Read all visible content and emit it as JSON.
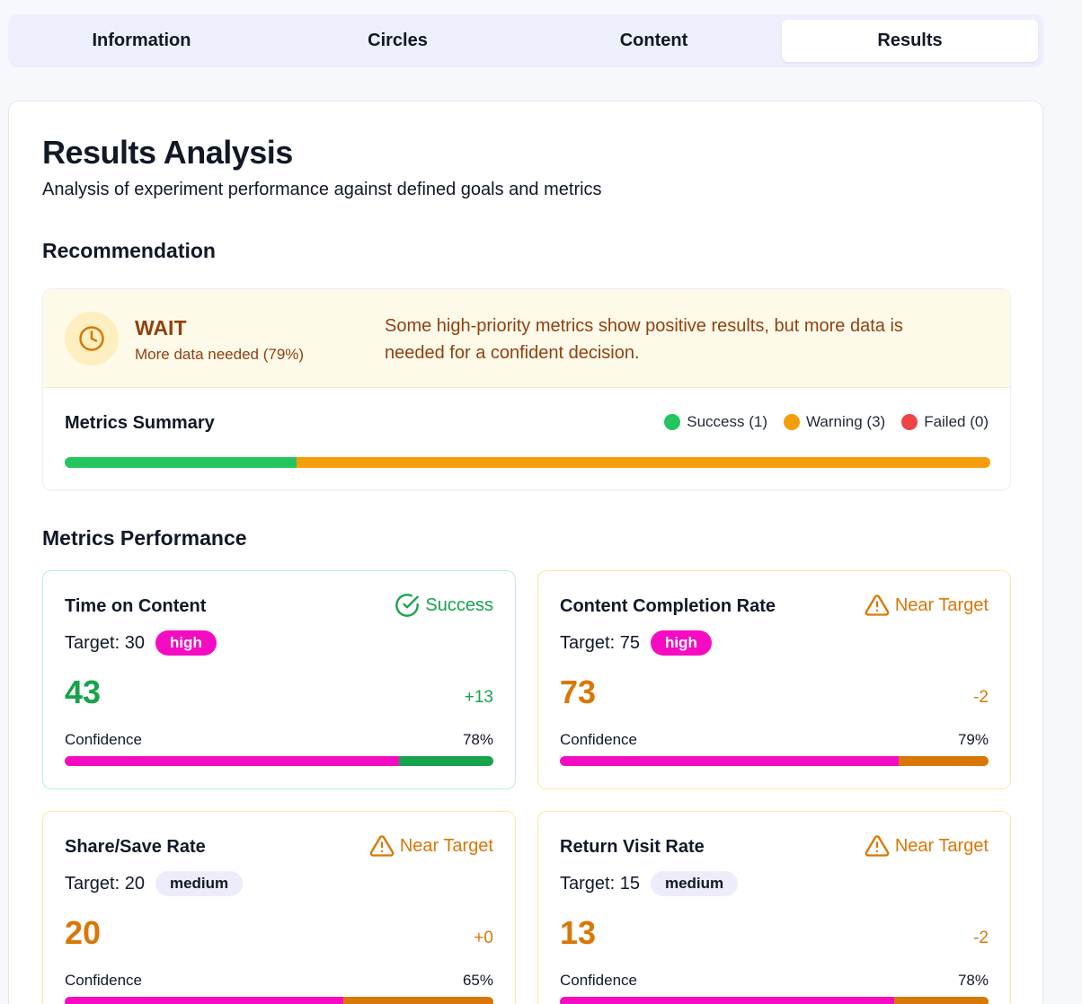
{
  "tabs": [
    {
      "label": "Information",
      "active": false
    },
    {
      "label": "Circles",
      "active": false
    },
    {
      "label": "Content",
      "active": false
    },
    {
      "label": "Results",
      "active": true
    }
  ],
  "page": {
    "title": "Results Analysis",
    "subtitle": "Analysis of experiment performance against defined goals and metrics"
  },
  "recommendation": {
    "section_title": "Recommendation",
    "icon": "clock-icon",
    "status": "WAIT",
    "sub": "More data needed (79%)",
    "message": "Some high-priority metrics show positive results, but more data is needed for a confident decision."
  },
  "summary": {
    "title": "Metrics Summary",
    "legend": [
      {
        "label": "Success (1)",
        "color": "#22c55e",
        "count": 1
      },
      {
        "label": "Warning (3)",
        "color": "#f59e0b",
        "count": 3
      },
      {
        "label": "Failed (0)",
        "color": "#ef4444",
        "count": 0
      }
    ]
  },
  "performance": {
    "section_title": "Metrics Performance",
    "metrics": [
      {
        "name": "Time on Content",
        "status": "Success",
        "status_icon": "check-circle-icon",
        "target_label": "Target: 30",
        "priority": "high",
        "value": "43",
        "delta": "+13",
        "confidence_label": "Confidence",
        "confidence_text": "78%",
        "confidence": 0.78,
        "color": "#16a34a",
        "kind": "success"
      },
      {
        "name": "Content Completion Rate",
        "status": "Near Target",
        "status_icon": "warning-triangle-icon",
        "target_label": "Target: 75",
        "priority": "high",
        "value": "73",
        "delta": "-2",
        "confidence_label": "Confidence",
        "confidence_text": "79%",
        "confidence": 0.79,
        "color": "#d97706",
        "kind": "warn"
      },
      {
        "name": "Share/Save Rate",
        "status": "Near Target",
        "status_icon": "warning-triangle-icon",
        "target_label": "Target: 20",
        "priority": "medium",
        "value": "20",
        "delta": "+0",
        "confidence_label": "Confidence",
        "confidence_text": "65%",
        "confidence": 0.65,
        "color": "#d97706",
        "kind": "warn"
      },
      {
        "name": "Return Visit Rate",
        "status": "Near Target",
        "status_icon": "warning-triangle-icon",
        "target_label": "Target: 15",
        "priority": "medium",
        "value": "13",
        "delta": "-2",
        "confidence_label": "Confidence",
        "confidence_text": "78%",
        "confidence": 0.78,
        "color": "#d97706",
        "kind": "warn"
      }
    ]
  },
  "colors": {
    "confidence_fill": "#f50cc2",
    "success": "#22c55e",
    "warning": "#f59e0b",
    "failed": "#ef4444"
  }
}
